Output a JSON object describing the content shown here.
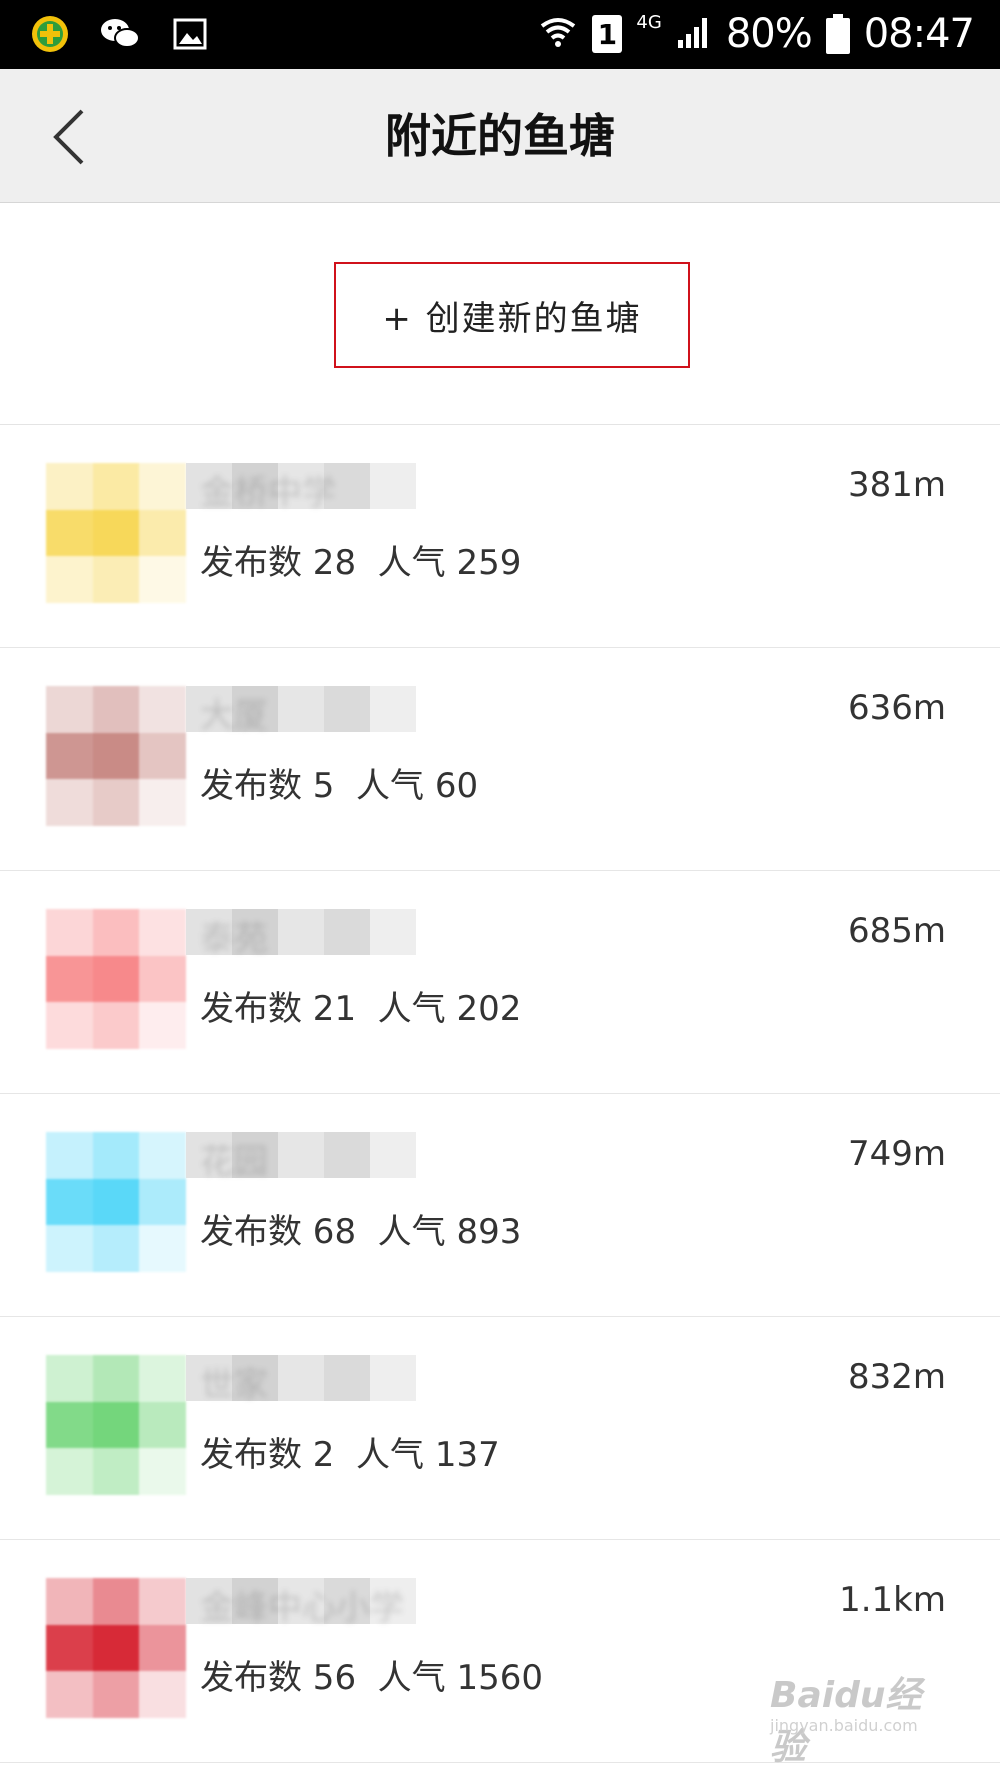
{
  "status_bar": {
    "battery_percent": "80%",
    "time": "08:47",
    "sim_slot": "1",
    "network": "4G",
    "app_icons": [
      "360-security-icon",
      "wechat-icon",
      "gallery-icon"
    ]
  },
  "nav": {
    "title": "附近的鱼塘",
    "back_icon": "chevron-left-icon"
  },
  "create": {
    "label": "+ 创建新的鱼塘",
    "highlight_color": "#d0111b"
  },
  "ponds": [
    {
      "name": "金桥中学",
      "stats": "发布数 28  人气 259",
      "distance": "381m",
      "thumb_color": "#f7d85a"
    },
    {
      "name": "大厦",
      "stats": "发布数 5  人气 60",
      "distance": "636m",
      "thumb_color": "#c98b86"
    },
    {
      "name": "泰苑",
      "stats": "发布数 21  人气 202",
      "distance": "685m",
      "thumb_color": "#f7898b"
    },
    {
      "name": "花园",
      "stats": "发布数 68  人气 893",
      "distance": "749m",
      "thumb_color": "#5ad8f8"
    },
    {
      "name": "世家",
      "stats": "发布数 2  人气 137",
      "distance": "832m",
      "thumb_color": "#74d67c"
    },
    {
      "name": "金峰中心小学",
      "stats": "发布数 56  人气 1560",
      "distance": "1.1km",
      "thumb_color": "#d72a37"
    }
  ],
  "watermark": {
    "brand": "Baidu经验",
    "url": "jingyan.baidu.com"
  }
}
